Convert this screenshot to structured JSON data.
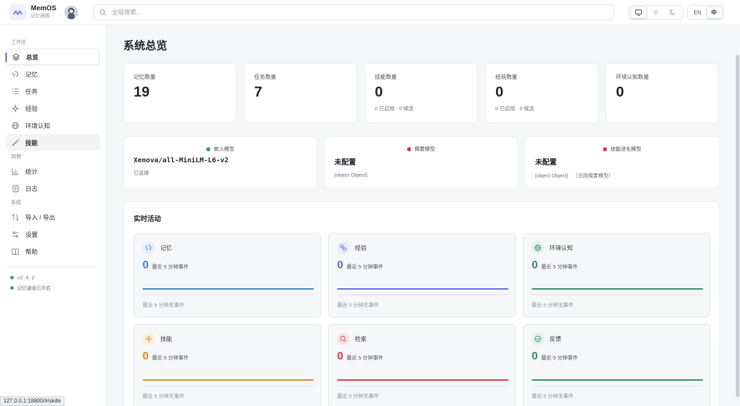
{
  "brand": {
    "name": "MemOS",
    "subtitle": "记忆面板"
  },
  "search": {
    "placeholder": "全局搜索..."
  },
  "lang": {
    "en": "EN",
    "zh": "中"
  },
  "sidebar": {
    "sections": [
      {
        "label": "工作区",
        "items": [
          {
            "label": "总览",
            "icon": "layers-icon"
          },
          {
            "label": "记忆",
            "icon": "memory-icon"
          },
          {
            "label": "任务",
            "icon": "list-icon"
          },
          {
            "label": "经验",
            "icon": "sparkle-icon"
          },
          {
            "label": "环境认知",
            "icon": "globe-icon"
          },
          {
            "label": "技能",
            "icon": "wand-icon"
          }
        ]
      },
      {
        "label": "洞察",
        "items": [
          {
            "label": "统计",
            "icon": "chart-icon"
          },
          {
            "label": "日志",
            "icon": "log-icon"
          }
        ]
      },
      {
        "label": "系统",
        "items": [
          {
            "label": "导入 / 导出",
            "icon": "transfer-icon"
          },
          {
            "label": "设置",
            "icon": "settings-icon"
          },
          {
            "label": "帮助",
            "icon": "book-icon"
          }
        ]
      }
    ],
    "version": "v2.0.2",
    "channel_status": "记忆通道已开启"
  },
  "status_url": "127.0.0.1:18800/#/skills",
  "page": {
    "title": "系统总览"
  },
  "stats": [
    {
      "label": "记忆数量",
      "value": "19",
      "sub": ""
    },
    {
      "label": "任务数量",
      "value": "7",
      "sub": ""
    },
    {
      "label": "技能数量",
      "value": "0",
      "sub": "0 已启用 · 0 候选"
    },
    {
      "label": "经验数量",
      "value": "0",
      "sub": "0 已启用 · 0 候选"
    },
    {
      "label": "环境认知数量",
      "value": "0",
      "sub": ""
    }
  ],
  "models": [
    {
      "label": "嵌入模型",
      "name": "Xenova/all-MiniLM-L6-v2",
      "sub": "已连接",
      "status_color": "#2ea05a"
    },
    {
      "label": "摘要模型",
      "name": "未配置",
      "sub": "[object Object]",
      "status_color": "#d9363e"
    },
    {
      "label": "技能进化模型",
      "name": "未配置",
      "sub": "[object Object] · （沿用摘要模型）",
      "status_color": "#d9363e"
    }
  ],
  "activity": {
    "title": "实时活动",
    "cards": [
      {
        "label": "记忆",
        "count": "0",
        "unit": "最近 5 分钟事件",
        "footer": "最近 5 分钟无事件",
        "color": "#3b82b8",
        "icon": "memory-icon"
      },
      {
        "label": "经验",
        "count": "0",
        "unit": "最近 5 分钟事件",
        "footer": "最近 5 分钟无事件",
        "color": "#5b6bd8",
        "icon": "link-icon"
      },
      {
        "label": "环境认知",
        "count": "0",
        "unit": "最近 5 分钟事件",
        "footer": "最近 5 分钟无事件",
        "color": "#2e8b5f",
        "icon": "globe-icon"
      },
      {
        "label": "技能",
        "count": "0",
        "unit": "最近 5 分钟事件",
        "footer": "最近 5 分钟无事件",
        "color": "#d98a1c",
        "icon": "sparkle-icon"
      },
      {
        "label": "检索",
        "count": "0",
        "unit": "最近 5 分钟事件",
        "footer": "最近 5 分钟无事件",
        "color": "#d9363e",
        "icon": "search-icon"
      },
      {
        "label": "反馈",
        "count": "0",
        "unit": "最近 5 分钟事件",
        "footer": "最近 5 分钟无事件",
        "color": "#2e8b5f",
        "icon": "check-circle-icon"
      }
    ]
  }
}
